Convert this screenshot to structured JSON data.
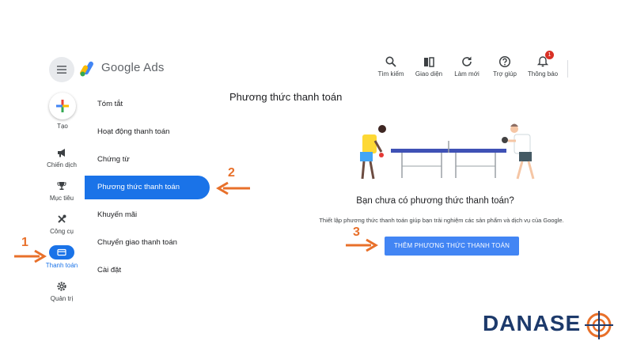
{
  "app": {
    "brand": "Google Ads"
  },
  "header": {
    "tools": [
      {
        "label": "Tìm kiếm",
        "icon": "search-icon"
      },
      {
        "label": "Giao diện",
        "icon": "appearance-icon"
      },
      {
        "label": "Làm mới",
        "icon": "refresh-icon"
      },
      {
        "label": "Trợ giúp",
        "icon": "help-icon"
      },
      {
        "label": "Thông báo",
        "icon": "bell-icon",
        "badge": "1"
      }
    ]
  },
  "sidebar": {
    "create_label": "Tạo",
    "items": [
      {
        "label": "Chiến dịch",
        "icon": "megaphone-icon"
      },
      {
        "label": "Mục tiêu",
        "icon": "trophy-icon"
      },
      {
        "label": "Công cụ",
        "icon": "tools-icon"
      },
      {
        "label": "Thanh toán",
        "icon": "credit-card-icon",
        "active": true
      },
      {
        "label": "Quản trị",
        "icon": "gear-icon"
      }
    ]
  },
  "submenu": {
    "items": [
      {
        "label": "Tóm tắt"
      },
      {
        "label": "Hoạt động thanh toán"
      },
      {
        "label": "Chứng từ"
      },
      {
        "label": "Phương thức thanh toán",
        "active": true
      },
      {
        "label": "Khuyến mãi"
      },
      {
        "label": "Chuyển giao thanh toán"
      },
      {
        "label": "Cài đặt"
      }
    ]
  },
  "main": {
    "title": "Phương thức thanh toán",
    "empty_title": "Bạn chưa có phương thức thanh toán?",
    "empty_desc": "Thiết lập phương thức thanh toán giúp bạn trải nghiệm các sản phẩm và dịch vụ của Google.",
    "add_button": "THÊM PHƯƠNG THỨC THANH TOÁN"
  },
  "annotations": {
    "step1": "1",
    "step2": "2",
    "step3": "3"
  },
  "watermark": {
    "text": "DANASE"
  },
  "colors": {
    "accent": "#1a73e8",
    "button": "#4285f4",
    "annotation": "#e8702a",
    "watermark": "#1d3a6b"
  }
}
